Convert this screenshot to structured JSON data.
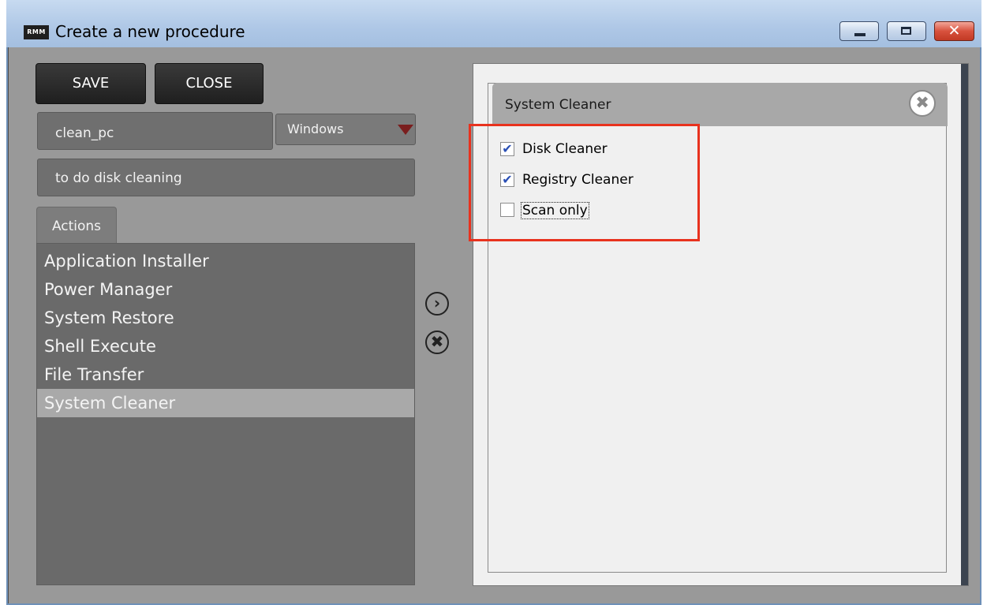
{
  "window": {
    "logo_text": "RMM",
    "title": "Create a new procedure",
    "controls": {
      "minimize": "–",
      "maximize": "□",
      "close": "✕"
    }
  },
  "toolbar": {
    "save_label": "SAVE",
    "close_label": "CLOSE"
  },
  "form": {
    "procedure_name": "clean_pc",
    "os_selected": "Windows",
    "description": "to do disk cleaning"
  },
  "actions": {
    "tab_label": "Actions",
    "items": [
      {
        "label": "Application Installer",
        "selected": false
      },
      {
        "label": "Power Manager",
        "selected": false
      },
      {
        "label": "System Restore",
        "selected": false
      },
      {
        "label": "Shell Execute",
        "selected": false
      },
      {
        "label": "File Transfer",
        "selected": false
      },
      {
        "label": "System Cleaner",
        "selected": true
      }
    ]
  },
  "middle_buttons": {
    "add_icon": "chevron-right-icon",
    "remove_icon": "close-circle-icon"
  },
  "card": {
    "title": "System Cleaner",
    "options": [
      {
        "label": "Disk Cleaner",
        "checked": true
      },
      {
        "label": "Registry Cleaner",
        "checked": true
      },
      {
        "label": "Scan only",
        "checked": false
      }
    ]
  },
  "colors": {
    "client_bg": "#999999",
    "button_dark": "#1f1f1f",
    "list_bg": "#6a6a6a",
    "selected_item": "#a9a9a9",
    "highlight": "#e8321e",
    "check_mark": "#2a4fb5"
  }
}
